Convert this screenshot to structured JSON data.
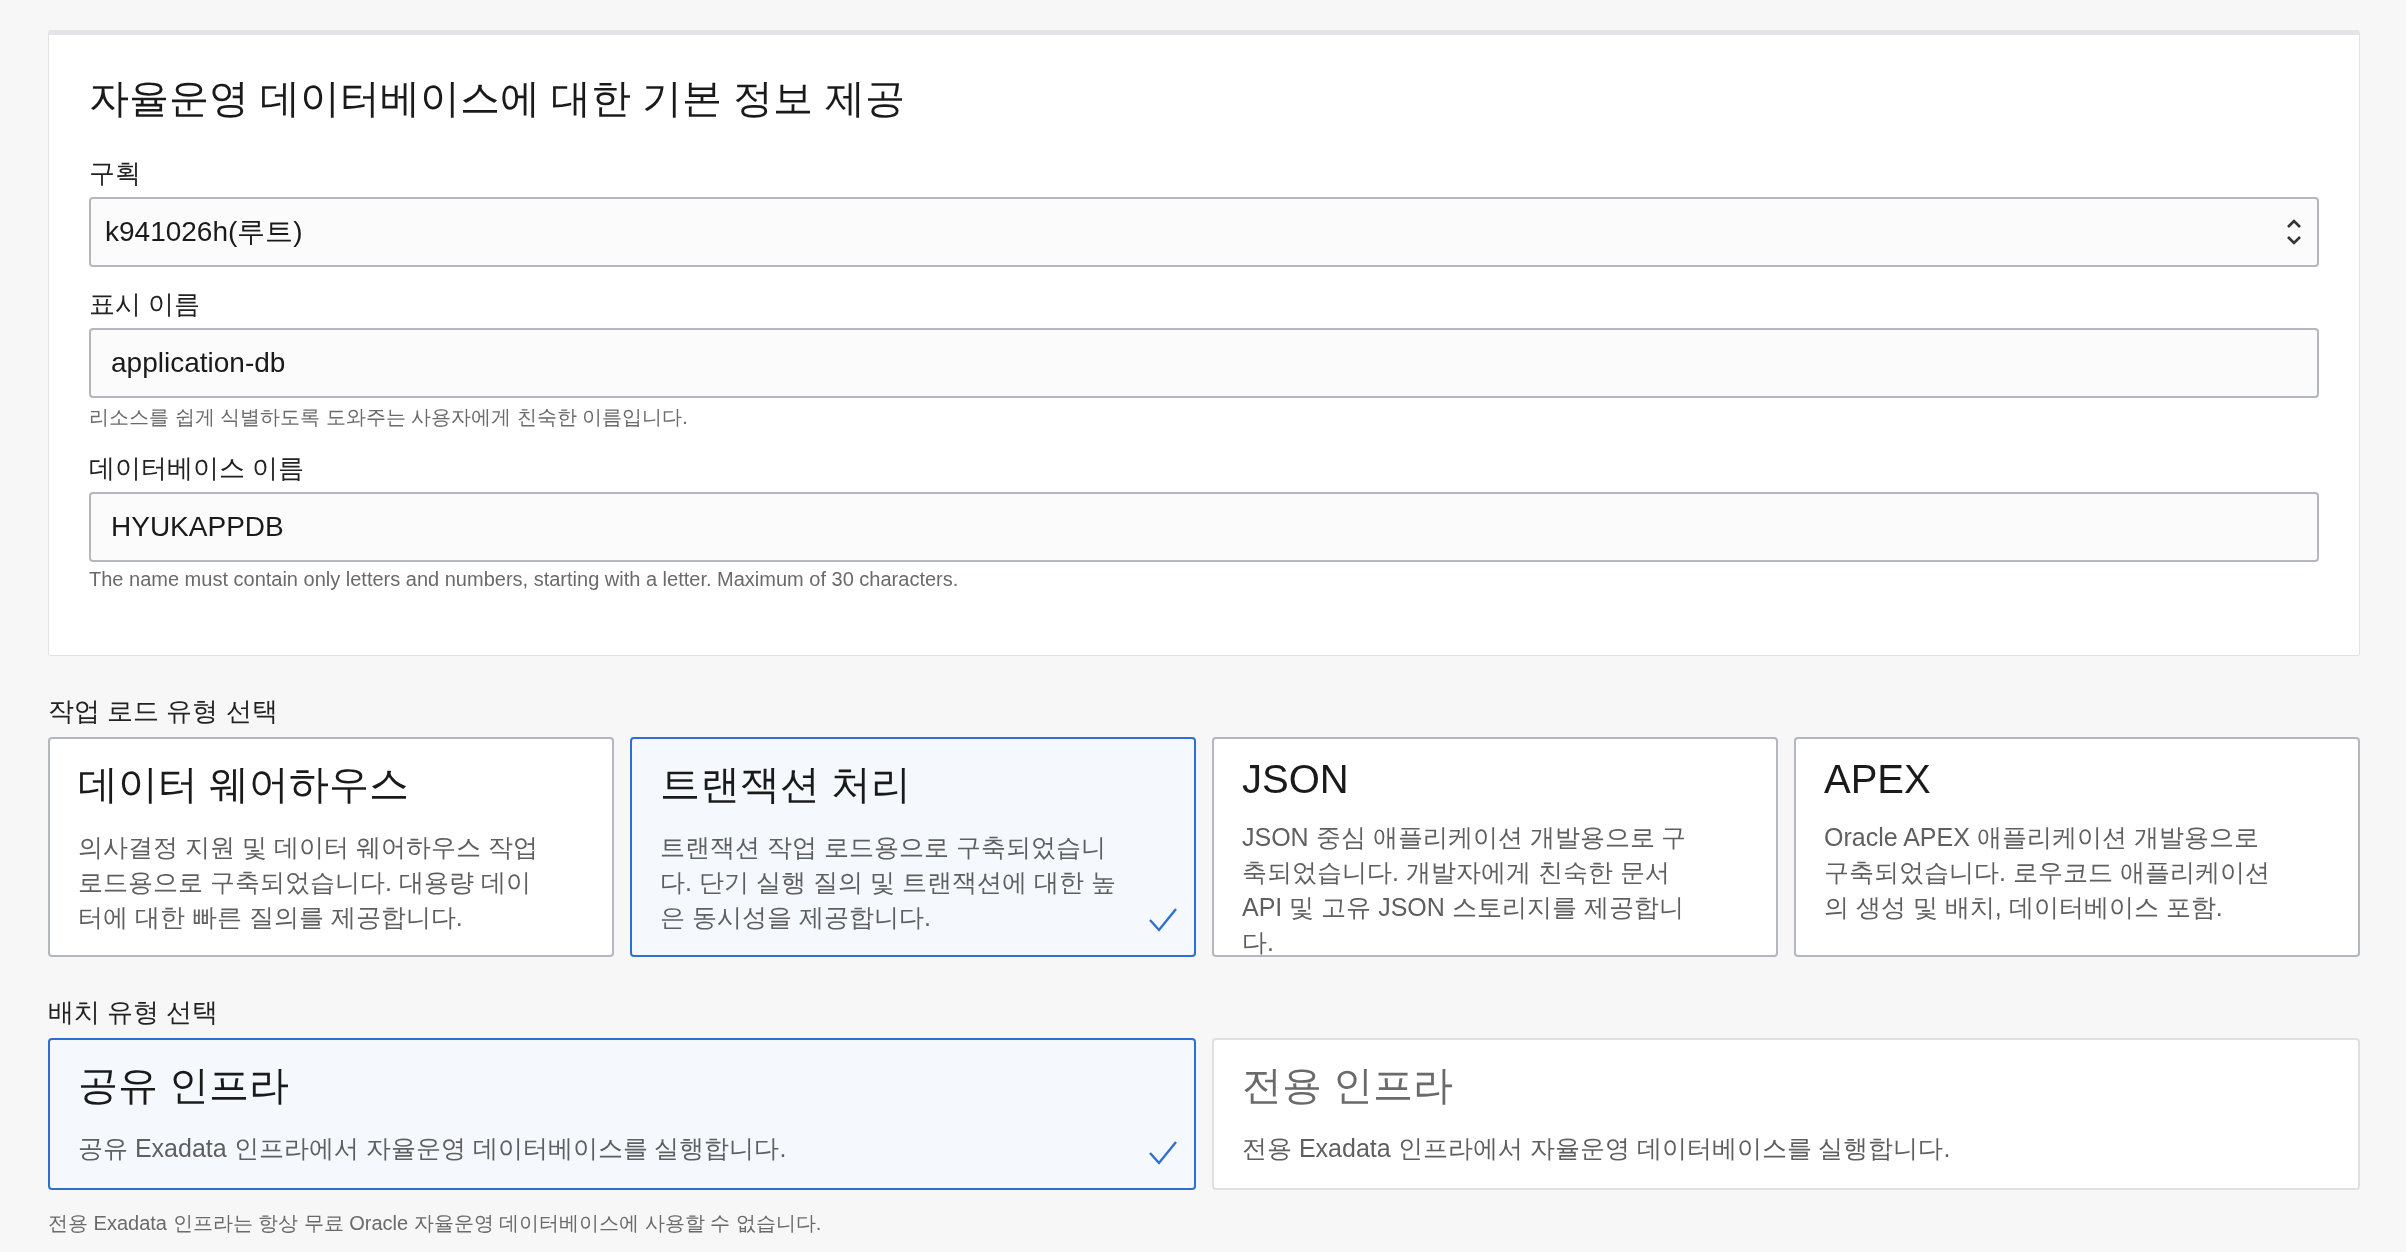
{
  "basic_info": {
    "title": "자율운영 데이터베이스에 대한 기본 정보 제공",
    "fields": [
      {
        "kind": "select",
        "label": "구획",
        "value": "k941026h(루트)"
      },
      {
        "kind": "text",
        "label": "표시 이름",
        "value": "application-db",
        "help": "리소스를 쉽게 식별하도록 도와주는 사용자에게 친숙한 이름입니다."
      },
      {
        "kind": "text",
        "label": "데이터베이스 이름",
        "value": "HYUKAPPDB",
        "help": "The name must contain only letters and numbers, starting with a letter. Maximum of 30 characters."
      }
    ]
  },
  "workload_type": {
    "label": "작업 로드 유형 선택",
    "options": [
      {
        "title": "데이터 웨어하우스",
        "description": "의사결정 지원 및 데이터 웨어하우스 작업 로드용으로 구축되었습니다. 대용량 데이터에 대한 빠른 질의를 제공합니다.",
        "selected": false
      },
      {
        "title": "트랜잭션 처리",
        "description": "트랜잭션 작업 로드용으로 구축되었습니다. 단기 실행 질의 및 트랜잭션에 대한 높은 동시성을 제공합니다.",
        "selected": true
      },
      {
        "title": "JSON",
        "description": "JSON 중심 애플리케이션 개발용으로 구축되었습니다. 개발자에게 친숙한 문서 API 및 고유 JSON 스토리지를 제공합니다.",
        "selected": false
      },
      {
        "title": "APEX",
        "description": "Oracle APEX 애플리케이션 개발용으로 구축되었습니다. 로우코드 애플리케이션의 생성 및 배치, 데이터베이스 포함.",
        "selected": false
      }
    ]
  },
  "deployment_type": {
    "label": "배치 유형 선택",
    "options": [
      {
        "title": "공유 인프라",
        "description": "공유 Exadata 인프라에서 자율운영 데이터베이스를 실행합니다.",
        "selected": true,
        "disabled": false
      },
      {
        "title": "전용 인프라",
        "description": "전용 Exadata 인프라에서 자율운영 데이터베이스를 실행합니다.",
        "selected": false,
        "disabled": true
      }
    ],
    "note": "전용 Exadata 인프라는 항상 무료 Oracle 자율운영 데이터베이스에 사용할 수 없습니다."
  }
}
